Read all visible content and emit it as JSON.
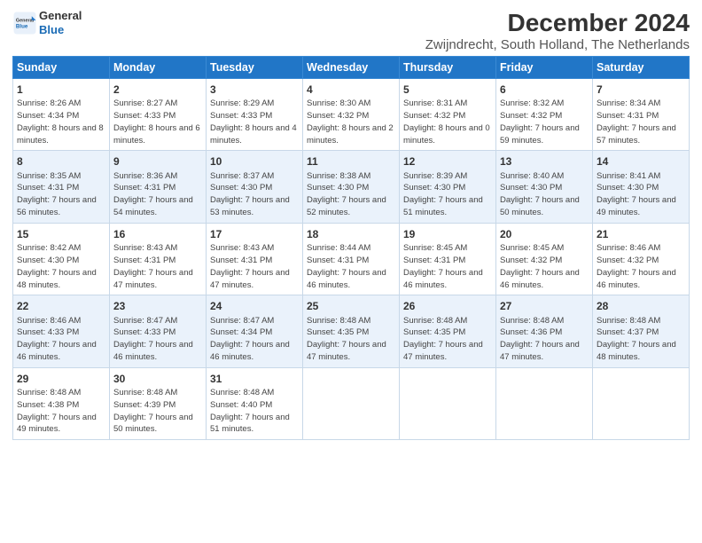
{
  "header": {
    "logo_line1": "General",
    "logo_line2": "Blue",
    "title": "December 2024",
    "subtitle": "Zwijndrecht, South Holland, The Netherlands"
  },
  "days_of_week": [
    "Sunday",
    "Monday",
    "Tuesday",
    "Wednesday",
    "Thursday",
    "Friday",
    "Saturday"
  ],
  "weeks": [
    [
      {
        "day": "1",
        "sunrise": "8:26 AM",
        "sunset": "4:34 PM",
        "daylight": "8 hours and 8 minutes."
      },
      {
        "day": "2",
        "sunrise": "8:27 AM",
        "sunset": "4:33 PM",
        "daylight": "8 hours and 6 minutes."
      },
      {
        "day": "3",
        "sunrise": "8:29 AM",
        "sunset": "4:33 PM",
        "daylight": "8 hours and 4 minutes."
      },
      {
        "day": "4",
        "sunrise": "8:30 AM",
        "sunset": "4:32 PM",
        "daylight": "8 hours and 2 minutes."
      },
      {
        "day": "5",
        "sunrise": "8:31 AM",
        "sunset": "4:32 PM",
        "daylight": "8 hours and 0 minutes."
      },
      {
        "day": "6",
        "sunrise": "8:32 AM",
        "sunset": "4:32 PM",
        "daylight": "7 hours and 59 minutes."
      },
      {
        "day": "7",
        "sunrise": "8:34 AM",
        "sunset": "4:31 PM",
        "daylight": "7 hours and 57 minutes."
      }
    ],
    [
      {
        "day": "8",
        "sunrise": "8:35 AM",
        "sunset": "4:31 PM",
        "daylight": "7 hours and 56 minutes."
      },
      {
        "day": "9",
        "sunrise": "8:36 AM",
        "sunset": "4:31 PM",
        "daylight": "7 hours and 54 minutes."
      },
      {
        "day": "10",
        "sunrise": "8:37 AM",
        "sunset": "4:30 PM",
        "daylight": "7 hours and 53 minutes."
      },
      {
        "day": "11",
        "sunrise": "8:38 AM",
        "sunset": "4:30 PM",
        "daylight": "7 hours and 52 minutes."
      },
      {
        "day": "12",
        "sunrise": "8:39 AM",
        "sunset": "4:30 PM",
        "daylight": "7 hours and 51 minutes."
      },
      {
        "day": "13",
        "sunrise": "8:40 AM",
        "sunset": "4:30 PM",
        "daylight": "7 hours and 50 minutes."
      },
      {
        "day": "14",
        "sunrise": "8:41 AM",
        "sunset": "4:30 PM",
        "daylight": "7 hours and 49 minutes."
      }
    ],
    [
      {
        "day": "15",
        "sunrise": "8:42 AM",
        "sunset": "4:30 PM",
        "daylight": "7 hours and 48 minutes."
      },
      {
        "day": "16",
        "sunrise": "8:43 AM",
        "sunset": "4:31 PM",
        "daylight": "7 hours and 47 minutes."
      },
      {
        "day": "17",
        "sunrise": "8:43 AM",
        "sunset": "4:31 PM",
        "daylight": "7 hours and 47 minutes."
      },
      {
        "day": "18",
        "sunrise": "8:44 AM",
        "sunset": "4:31 PM",
        "daylight": "7 hours and 46 minutes."
      },
      {
        "day": "19",
        "sunrise": "8:45 AM",
        "sunset": "4:31 PM",
        "daylight": "7 hours and 46 minutes."
      },
      {
        "day": "20",
        "sunrise": "8:45 AM",
        "sunset": "4:32 PM",
        "daylight": "7 hours and 46 minutes."
      },
      {
        "day": "21",
        "sunrise": "8:46 AM",
        "sunset": "4:32 PM",
        "daylight": "7 hours and 46 minutes."
      }
    ],
    [
      {
        "day": "22",
        "sunrise": "8:46 AM",
        "sunset": "4:33 PM",
        "daylight": "7 hours and 46 minutes."
      },
      {
        "day": "23",
        "sunrise": "8:47 AM",
        "sunset": "4:33 PM",
        "daylight": "7 hours and 46 minutes."
      },
      {
        "day": "24",
        "sunrise": "8:47 AM",
        "sunset": "4:34 PM",
        "daylight": "7 hours and 46 minutes."
      },
      {
        "day": "25",
        "sunrise": "8:48 AM",
        "sunset": "4:35 PM",
        "daylight": "7 hours and 47 minutes."
      },
      {
        "day": "26",
        "sunrise": "8:48 AM",
        "sunset": "4:35 PM",
        "daylight": "7 hours and 47 minutes."
      },
      {
        "day": "27",
        "sunrise": "8:48 AM",
        "sunset": "4:36 PM",
        "daylight": "7 hours and 47 minutes."
      },
      {
        "day": "28",
        "sunrise": "8:48 AM",
        "sunset": "4:37 PM",
        "daylight": "7 hours and 48 minutes."
      }
    ],
    [
      {
        "day": "29",
        "sunrise": "8:48 AM",
        "sunset": "4:38 PM",
        "daylight": "7 hours and 49 minutes."
      },
      {
        "day": "30",
        "sunrise": "8:48 AM",
        "sunset": "4:39 PM",
        "daylight": "7 hours and 50 minutes."
      },
      {
        "day": "31",
        "sunrise": "8:48 AM",
        "sunset": "4:40 PM",
        "daylight": "7 hours and 51 minutes."
      },
      {
        "day": "",
        "sunrise": "",
        "sunset": "",
        "daylight": ""
      },
      {
        "day": "",
        "sunrise": "",
        "sunset": "",
        "daylight": ""
      },
      {
        "day": "",
        "sunrise": "",
        "sunset": "",
        "daylight": ""
      },
      {
        "day": "",
        "sunrise": "",
        "sunset": "",
        "daylight": ""
      }
    ]
  ],
  "labels": {
    "sunrise": "Sunrise:",
    "sunset": "Sunset:",
    "daylight": "Daylight:"
  }
}
